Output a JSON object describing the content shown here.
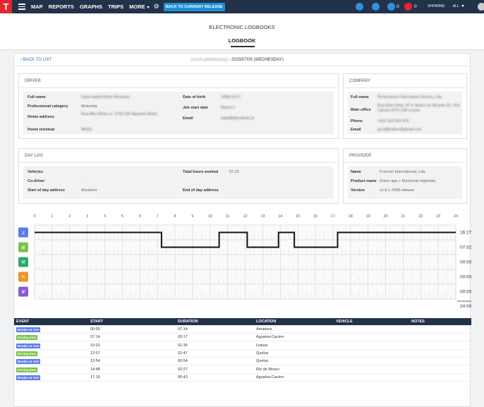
{
  "nav": {
    "logo": "T",
    "items": [
      "MAP",
      "REPORTS",
      "GRAPHS",
      "TRIPS"
    ],
    "more_label": "MORE",
    "release_button": "BACK TO CURRENT RELEASE",
    "notif_counts": [
      "0",
      "0"
    ],
    "showing_label": "SHOWING",
    "showing_value": "ALL"
  },
  "subheader": {
    "title": "ELECTRONIC LOGBOOKS",
    "tab": "LOGBOOK"
  },
  "header": {
    "back_label": "BACK TO LIST",
    "driver_code": "CATIA (BRNAGCD)",
    "date": "- 2023/07/05 (WEDNESDAY)"
  },
  "driver": {
    "title": "DRIVER",
    "full_name_label": "Full name",
    "full_name": "Catia Isabel Britez Bernardo",
    "category_label": "Professional category",
    "category": "Motorista",
    "address_label": "Home address",
    "address": "Rua Mira Sintra Lt. 2735-032 Agualva-Sintra",
    "terminal_label": "Home terminal",
    "terminal": "90031",
    "dob_label": "Date of birth",
    "dob": "1988-03-07",
    "job_start_label": "Job start date",
    "job_start": "March 1",
    "email_label": "Email",
    "email": "katia88@outlook.pt"
  },
  "company": {
    "title": "COMPANY",
    "full_name_label": "Full name",
    "full_name": "Performance Recreation Drivers, Lda",
    "office_label": "Main office",
    "office": "Rua Dom Dinis, Nº 4, Bairro do Mirante 16, 3ª/a Caneis 2070-108 Loures",
    "phone_label": "Phone",
    "phone": "+351 913 803 875",
    "email_label": "Email",
    "email": "geral@mbmr@gmail.com"
  },
  "daylog": {
    "title": "DAY LOG",
    "vehicles_label": "Vehicles",
    "vehicles": "",
    "codriver_label": "Co-driver",
    "codriver": "-",
    "start_addr_label": "Start of day address",
    "start_addr": "Amadora",
    "total_label": "Total hours worked",
    "total": "07:32",
    "end_addr_label": "End of day address",
    "end_addr": ""
  },
  "provider": {
    "title": "PROVIDER",
    "name_label": "Name",
    "name": "Frotcom International, Lda.",
    "product_label": "Product name",
    "product": "Driver app + Electronic logbooks",
    "version_label": "Version",
    "version": "v1.8.1-2468-release"
  },
  "chart_data": {
    "type": "step",
    "hours": [
      "0",
      "1",
      "2",
      "3",
      "4",
      "5",
      "6",
      "7",
      "8",
      "9",
      "10",
      "11",
      "12",
      "13",
      "14",
      "15",
      "16",
      "17",
      "18",
      "19",
      "20",
      "21",
      "22",
      "23",
      "24"
    ],
    "rows": [
      {
        "icon": "bed-icon",
        "color": "#5b7de8",
        "total": "16:27"
      },
      {
        "icon": "steering-wheel-icon",
        "color": "#7cc24a",
        "total": "07:32"
      },
      {
        "icon": "tools-icon",
        "color": "#2ea86b",
        "total": "00:00"
      },
      {
        "icon": "edit-icon",
        "color": "#f0932b",
        "total": "00:00"
      },
      {
        "icon": "hash-icon",
        "color": "#8a5bd6",
        "total": "00:00"
      }
    ],
    "grand_total": "24:00",
    "segments": [
      {
        "start": 0,
        "end": 7.2333,
        "row": 0
      },
      {
        "start": 7.2333,
        "end": 10.5167,
        "row": 1
      },
      {
        "start": 10.5167,
        "end": 12.1167,
        "row": 0
      },
      {
        "start": 12.1167,
        "end": 13.9,
        "row": 1
      },
      {
        "start": 13.9,
        "end": 14.8,
        "row": 0
      },
      {
        "start": 14.8,
        "end": 17.2667,
        "row": 1
      },
      {
        "start": 17.2667,
        "end": 24,
        "row": 0
      }
    ]
  },
  "events": {
    "headers": [
      "EVENT",
      "START",
      "DURATION",
      "LOCATION",
      "VEHICLE",
      "NOTES"
    ],
    "rows": [
      {
        "event": "Breaks or rest",
        "color": "#5b7de8",
        "start": "00:00",
        "duration": "07:14",
        "location": "Amadora"
      },
      {
        "event": "Driving time",
        "color": "#7cc24a",
        "start": "07:14",
        "duration": "03:17",
        "location": "Agualva-Cacém"
      },
      {
        "event": "Breaks or rest",
        "color": "#5b7de8",
        "start": "10:31",
        "duration": "01:35",
        "location": "Lisboa"
      },
      {
        "event": "Driving time",
        "color": "#7cc24a",
        "start": "12:07",
        "duration": "01:47",
        "location": "Queluz"
      },
      {
        "event": "Breaks or rest",
        "color": "#5b7de8",
        "start": "13:54",
        "duration": "00:54",
        "location": "Queluz"
      },
      {
        "event": "Driving time",
        "color": "#7cc24a",
        "start": "14:48",
        "duration": "02:27",
        "location": "Rio de Mouro"
      },
      {
        "event": "Breaks or rest",
        "color": "#5b7de8",
        "start": "17:16",
        "duration": "06:43",
        "location": "Agualva-Cacém"
      }
    ]
  }
}
